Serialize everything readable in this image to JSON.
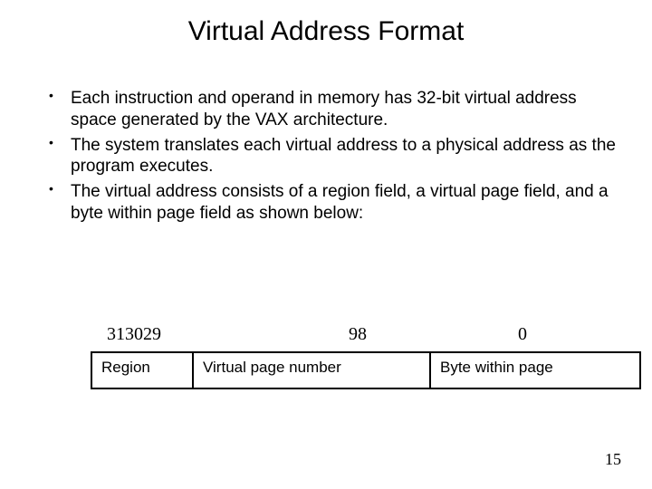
{
  "title": "Virtual Address Format",
  "bullets": [
    "Each instruction and operand in memory has 32-bit virtual address space generated by the VAX architecture.",
    "The system translates each virtual address to a physical address as the program executes.",
    "The virtual address consists of a region field, a virtual page field, and a byte within page field as shown below:"
  ],
  "bit_labels": {
    "left": "313029",
    "mid": "98",
    "right": "0"
  },
  "fields": {
    "region": "Region",
    "vpn": "Virtual page number",
    "byte": "Byte within page"
  },
  "page_number": "15"
}
